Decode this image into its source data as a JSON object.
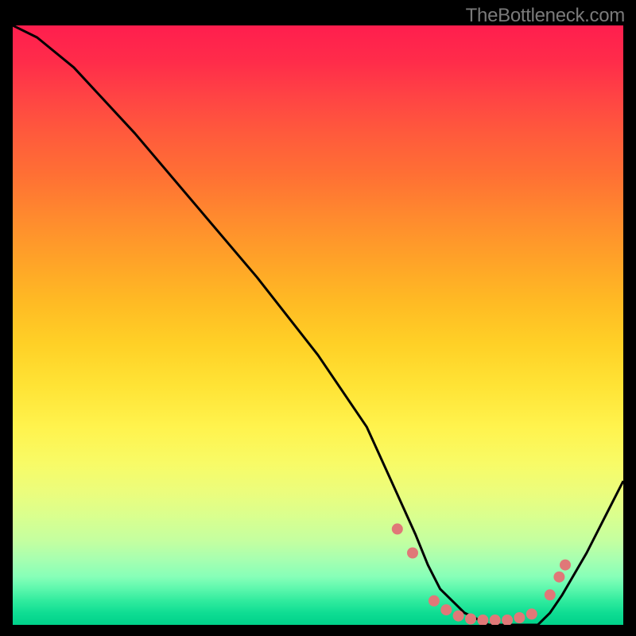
{
  "attribution": "TheBottleneck.com",
  "chart_data": {
    "type": "line",
    "title": "",
    "xlabel": "",
    "ylabel": "",
    "xlim": [
      0,
      100
    ],
    "ylim": [
      0,
      100
    ],
    "curve": {
      "name": "bottleneck-curve",
      "x": [
        0,
        4,
        10,
        20,
        30,
        40,
        50,
        58,
        62,
        66,
        68,
        70,
        74,
        78,
        82,
        86,
        88,
        90,
        94,
        100
      ],
      "y": [
        100,
        98,
        93,
        82,
        70,
        58,
        45,
        33,
        24,
        15,
        10,
        6,
        2,
        0,
        0,
        0,
        2,
        5,
        12,
        24
      ]
    },
    "markers": {
      "color": "#e07878",
      "points": [
        {
          "x": 63,
          "y": 16
        },
        {
          "x": 65.5,
          "y": 12
        },
        {
          "x": 69,
          "y": 4
        },
        {
          "x": 71,
          "y": 2.5
        },
        {
          "x": 73,
          "y": 1.5
        },
        {
          "x": 75,
          "y": 1
        },
        {
          "x": 77,
          "y": 0.8
        },
        {
          "x": 79,
          "y": 0.8
        },
        {
          "x": 81,
          "y": 0.8
        },
        {
          "x": 83,
          "y": 1.2
        },
        {
          "x": 85,
          "y": 1.8
        },
        {
          "x": 88,
          "y": 5
        },
        {
          "x": 89.5,
          "y": 8
        },
        {
          "x": 90.5,
          "y": 10
        }
      ]
    },
    "gradient_stops": [
      {
        "pos": 0.0,
        "color": "#ff1e4e"
      },
      {
        "pos": 0.25,
        "color": "#ff7034"
      },
      {
        "pos": 0.5,
        "color": "#ffd026"
      },
      {
        "pos": 0.75,
        "color": "#ebfd7d"
      },
      {
        "pos": 1.0,
        "color": "#00d18a"
      }
    ]
  }
}
